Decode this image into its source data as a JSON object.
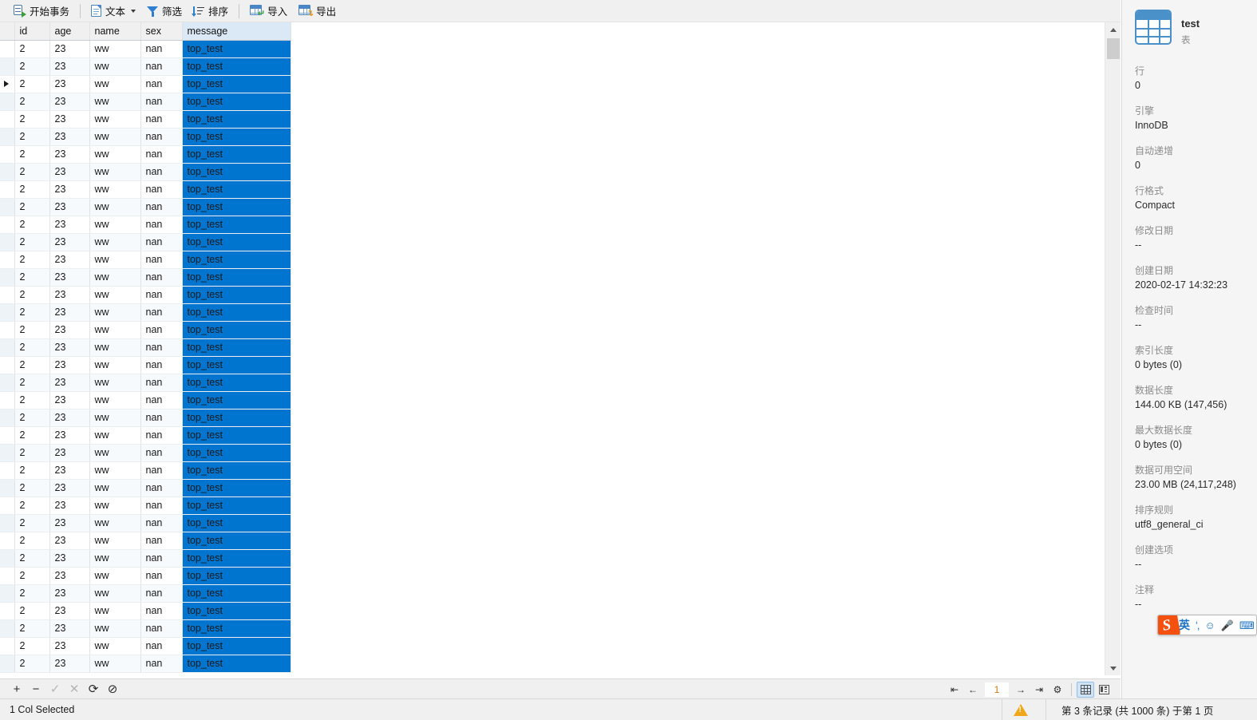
{
  "toolbar": {
    "items": [
      {
        "label": "开始事务",
        "icon": "transaction-icon",
        "caret": false
      },
      {
        "label": "文本",
        "icon": "text-doc-icon",
        "caret": true
      },
      {
        "label": "筛选",
        "icon": "filter-icon",
        "caret": false
      },
      {
        "label": "排序",
        "icon": "sort-icon",
        "caret": false
      },
      {
        "label": "导入",
        "icon": "import-icon",
        "caret": false
      },
      {
        "label": "导出",
        "icon": "export-icon",
        "caret": false
      }
    ]
  },
  "grid": {
    "columns": [
      "id",
      "age",
      "name",
      "sex",
      "message"
    ],
    "selected_column": "message",
    "current_row_index": 2,
    "rows": [
      [
        "2",
        "23",
        "ww",
        "nan",
        "top_test"
      ],
      [
        "2",
        "23",
        "ww",
        "nan",
        "top_test"
      ],
      [
        "2",
        "23",
        "ww",
        "nan",
        "top_test"
      ],
      [
        "2",
        "23",
        "ww",
        "nan",
        "top_test"
      ],
      [
        "2",
        "23",
        "ww",
        "nan",
        "top_test"
      ],
      [
        "2",
        "23",
        "ww",
        "nan",
        "top_test"
      ],
      [
        "2",
        "23",
        "ww",
        "nan",
        "top_test"
      ],
      [
        "2",
        "23",
        "ww",
        "nan",
        "top_test"
      ],
      [
        "2",
        "23",
        "ww",
        "nan",
        "top_test"
      ],
      [
        "2",
        "23",
        "ww",
        "nan",
        "top_test"
      ],
      [
        "2",
        "23",
        "ww",
        "nan",
        "top_test"
      ],
      [
        "2",
        "23",
        "ww",
        "nan",
        "top_test"
      ],
      [
        "2",
        "23",
        "ww",
        "nan",
        "top_test"
      ],
      [
        "2",
        "23",
        "ww",
        "nan",
        "top_test"
      ],
      [
        "2",
        "23",
        "ww",
        "nan",
        "top_test"
      ],
      [
        "2",
        "23",
        "ww",
        "nan",
        "top_test"
      ],
      [
        "2",
        "23",
        "ww",
        "nan",
        "top_test"
      ],
      [
        "2",
        "23",
        "ww",
        "nan",
        "top_test"
      ],
      [
        "2",
        "23",
        "ww",
        "nan",
        "top_test"
      ],
      [
        "2",
        "23",
        "ww",
        "nan",
        "top_test"
      ],
      [
        "2",
        "23",
        "ww",
        "nan",
        "top_test"
      ],
      [
        "2",
        "23",
        "ww",
        "nan",
        "top_test"
      ],
      [
        "2",
        "23",
        "ww",
        "nan",
        "top_test"
      ],
      [
        "2",
        "23",
        "ww",
        "nan",
        "top_test"
      ],
      [
        "2",
        "23",
        "ww",
        "nan",
        "top_test"
      ],
      [
        "2",
        "23",
        "ww",
        "nan",
        "top_test"
      ],
      [
        "2",
        "23",
        "ww",
        "nan",
        "top_test"
      ],
      [
        "2",
        "23",
        "ww",
        "nan",
        "top_test"
      ],
      [
        "2",
        "23",
        "ww",
        "nan",
        "top_test"
      ],
      [
        "2",
        "23",
        "ww",
        "nan",
        "top_test"
      ],
      [
        "2",
        "23",
        "ww",
        "nan",
        "top_test"
      ],
      [
        "2",
        "23",
        "ww",
        "nan",
        "top_test"
      ],
      [
        "2",
        "23",
        "ww",
        "nan",
        "top_test"
      ],
      [
        "2",
        "23",
        "ww",
        "nan",
        "top_test"
      ],
      [
        "2",
        "23",
        "ww",
        "nan",
        "top_test"
      ],
      [
        "2",
        "23",
        "ww",
        "nan",
        "top_test"
      ]
    ]
  },
  "record_bar": {
    "buttons": [
      {
        "name": "add-record",
        "glyph": "+",
        "enabled": true
      },
      {
        "name": "delete-record",
        "glyph": "−",
        "enabled": true
      },
      {
        "name": "confirm-edit",
        "glyph": "✓",
        "enabled": false
      },
      {
        "name": "cancel-edit",
        "glyph": "✕",
        "enabled": false
      },
      {
        "name": "refresh",
        "glyph": "⟳",
        "enabled": true
      },
      {
        "name": "stop",
        "glyph": "⊘",
        "enabled": true
      }
    ],
    "nav": [
      {
        "name": "first-page",
        "glyph": "⇤"
      },
      {
        "name": "previous-page",
        "glyph": "←"
      }
    ],
    "nav_after": [
      {
        "name": "next-page",
        "glyph": "→"
      },
      {
        "name": "last-page",
        "glyph": "⇥"
      },
      {
        "name": "settings",
        "glyph": "⚙"
      }
    ],
    "page_value": "1",
    "views": [
      {
        "name": "grid-view",
        "active": true
      },
      {
        "name": "form-view",
        "active": false
      }
    ]
  },
  "status_bar": {
    "left": "1 Col Selected",
    "right": "第 3 条记录 (共 1000 条) 于第 1 页"
  },
  "sidebar": {
    "title": "test",
    "subtitle": "表",
    "meta": [
      {
        "key": "行",
        "value": "0"
      },
      {
        "key": "引擎",
        "value": "InnoDB"
      },
      {
        "key": "自动递增",
        "value": "0"
      },
      {
        "key": "行格式",
        "value": "Compact"
      },
      {
        "key": "修改日期",
        "value": "--"
      },
      {
        "key": "创建日期",
        "value": "2020-02-17 14:32:23"
      },
      {
        "key": "检查时间",
        "value": "--"
      },
      {
        "key": "索引长度",
        "value": "0 bytes (0)"
      },
      {
        "key": "数据长度",
        "value": "144.00 KB (147,456)"
      },
      {
        "key": "最大数据长度",
        "value": "0 bytes (0)"
      },
      {
        "key": "数据可用空间",
        "value": "23.00 MB (24,117,248)"
      },
      {
        "key": "排序规则",
        "value": "utf8_general_ci"
      },
      {
        "key": "创建选项",
        "value": "--"
      },
      {
        "key": "注释",
        "value": "--"
      }
    ]
  },
  "ime": {
    "logo": "S",
    "items": [
      {
        "name": "input-mode-english",
        "glyph": "英"
      },
      {
        "name": "punctuation-toggle",
        "glyph": "ʻ,"
      },
      {
        "name": "emoji-picker",
        "glyph": "☺"
      },
      {
        "name": "voice-input",
        "glyph": "🎤"
      },
      {
        "name": "soft-keyboard",
        "glyph": "⌨"
      }
    ]
  },
  "colors": {
    "selection_blue": "#0075d0",
    "toolbar_bg": "#f0f0f0",
    "header_sel": "#dbe9f7",
    "accent_orange": "#d07b12"
  }
}
